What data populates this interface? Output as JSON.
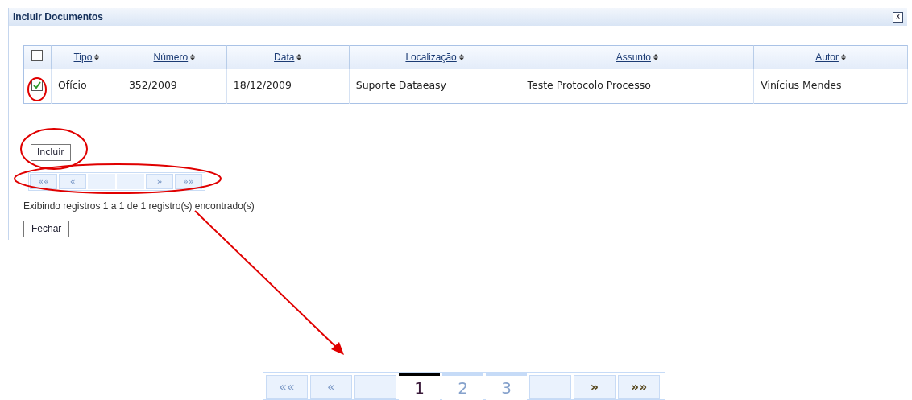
{
  "dialog": {
    "title": "Incluir Documentos",
    "close_label": "X"
  },
  "table": {
    "select_all": {
      "checked": false
    },
    "columns": [
      "Tipo",
      "Número",
      "Data",
      "Localização",
      "Assunto",
      "Autor"
    ],
    "rows": [
      {
        "checked": true,
        "cells": [
          "Ofício",
          "352/2009",
          "18/12/2009",
          "Suporte Dataeasy",
          "Teste Protocolo Processo",
          "Vinícius Mendes"
        ]
      }
    ]
  },
  "include_button": "Incluir",
  "pager": [
    {
      "kind": "nav",
      "label": "««"
    },
    {
      "kind": "nav",
      "label": "«"
    },
    {
      "kind": "blank"
    },
    {
      "kind": "blank"
    },
    {
      "kind": "nav",
      "label": "»"
    },
    {
      "kind": "nav",
      "label": "»»"
    }
  ],
  "status": "Exibindo registros 1 a 1 de 1 registro(s) encontrado(s)",
  "close_button": "Fechar",
  "pager_zoom": [
    {
      "kind": "nav",
      "label": "««",
      "enabled": false
    },
    {
      "kind": "nav",
      "label": "«",
      "enabled": false
    },
    {
      "kind": "blank"
    },
    {
      "kind": "page",
      "label": "1",
      "selected": true
    },
    {
      "kind": "page",
      "label": "2",
      "selected": false
    },
    {
      "kind": "page",
      "label": "3",
      "selected": false
    },
    {
      "kind": "blank"
    },
    {
      "kind": "nav",
      "label": "»",
      "enabled": true
    },
    {
      "kind": "nav",
      "label": "»»",
      "enabled": true
    }
  ]
}
